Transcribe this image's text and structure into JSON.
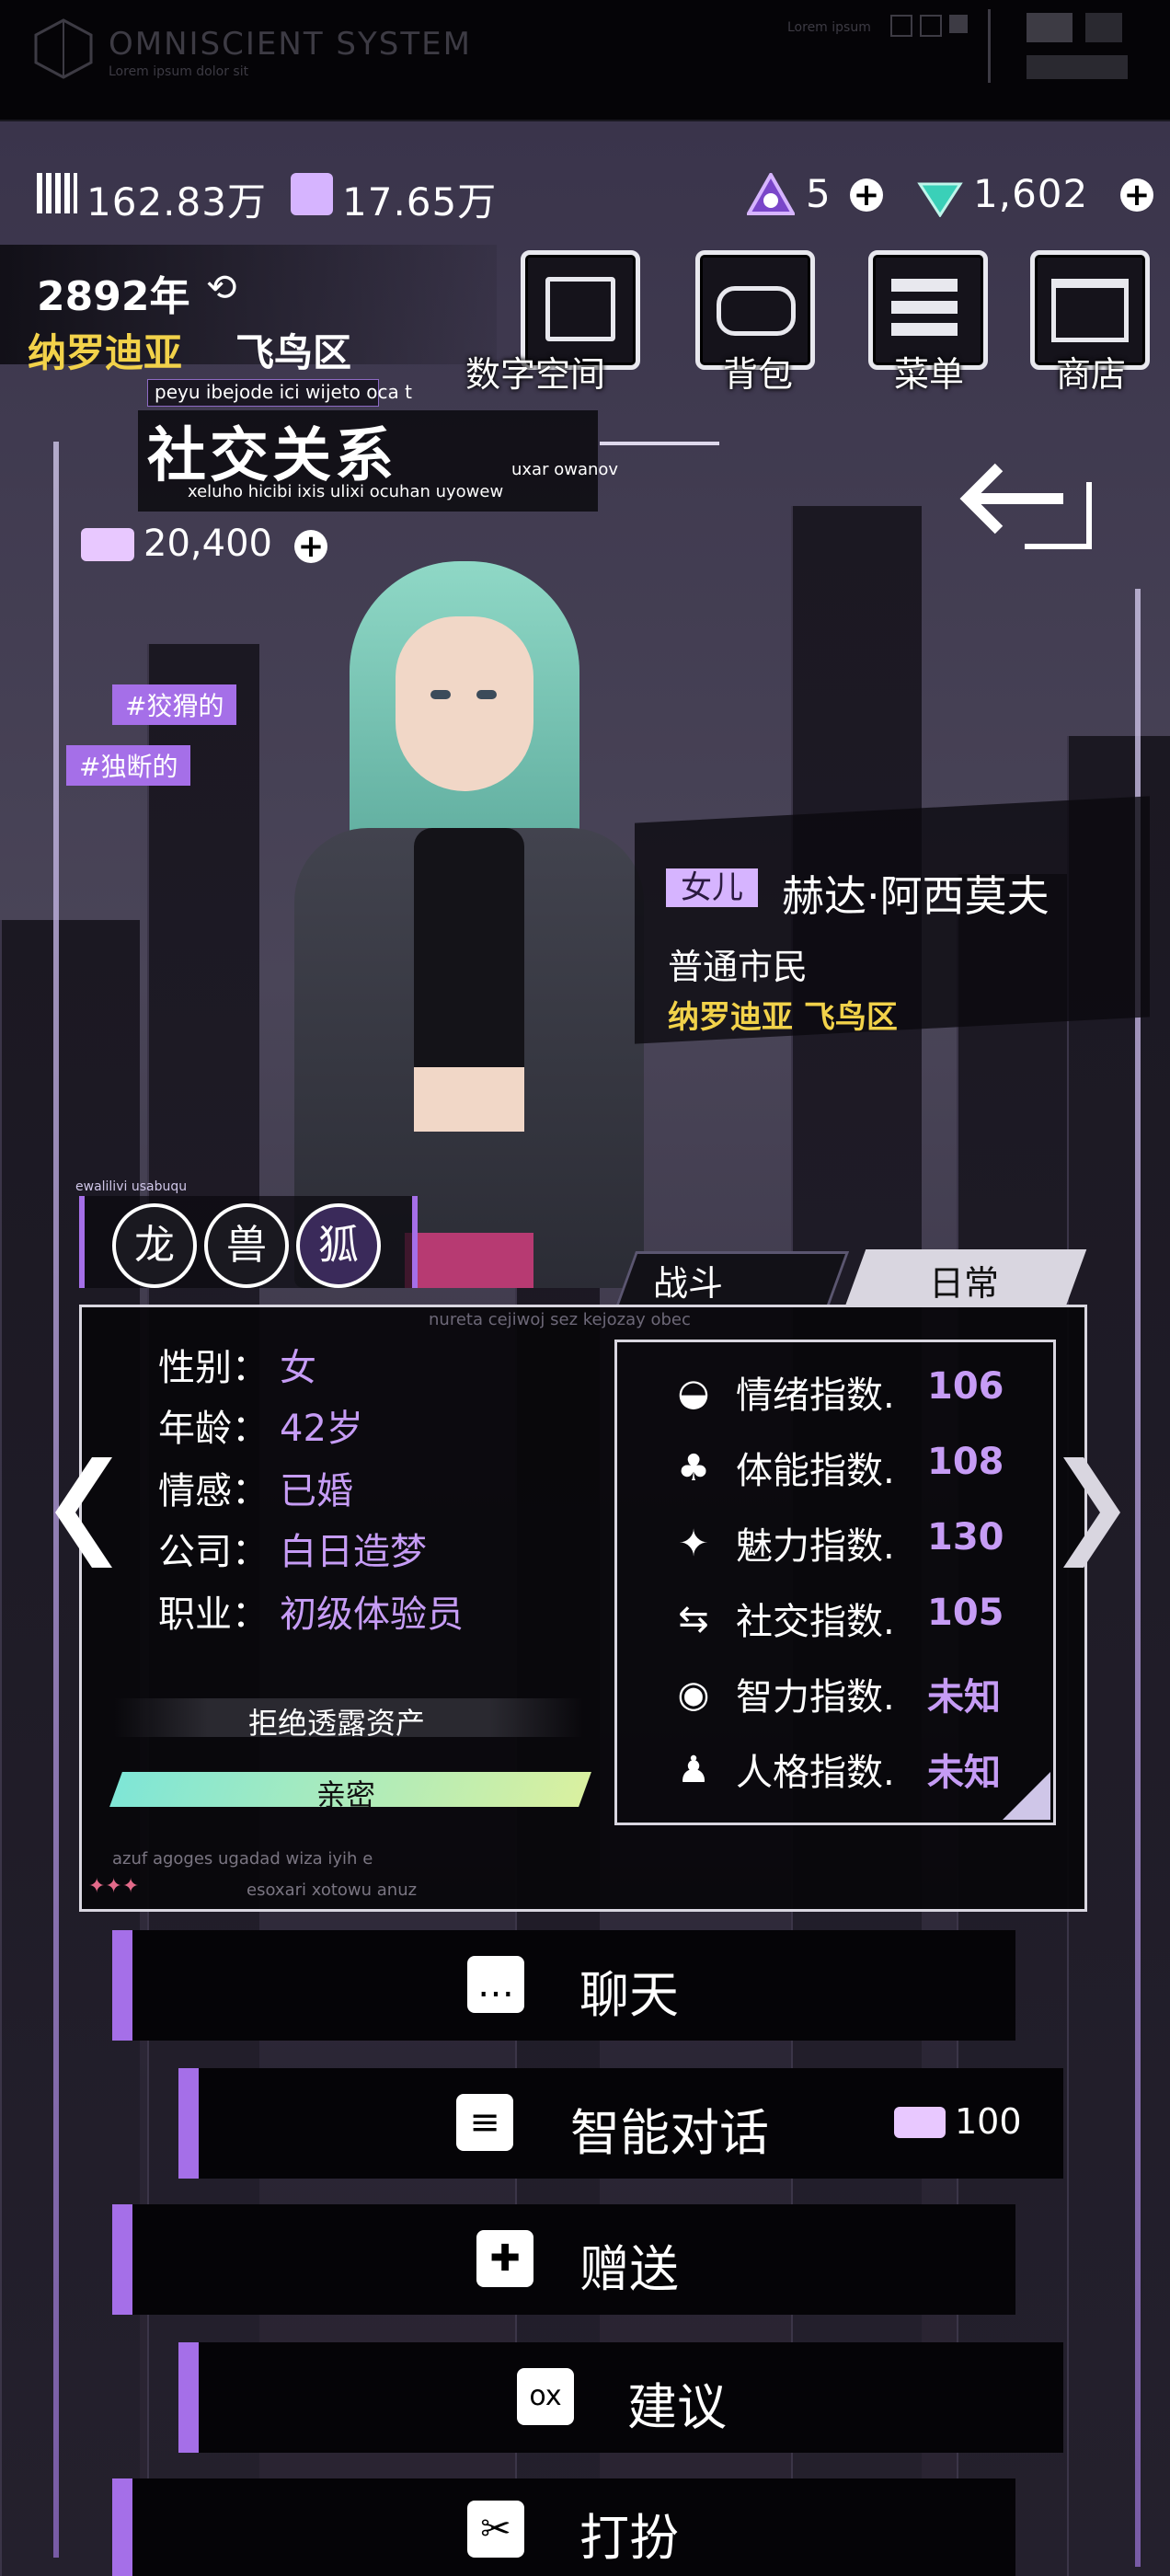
{
  "topbar": {
    "logo_title": "OMNISCIENT SYSTEM",
    "logo_sub": "Lorem ipsum dolor sit",
    "right_text": "Lorem ipsum"
  },
  "resources": {
    "coins": "162.83万",
    "crystals": "17.65万",
    "energy": "5",
    "gems": "1,602"
  },
  "location": {
    "year": "2892年",
    "city": "纳罗迪亚",
    "district": "飞鸟区"
  },
  "nav": {
    "digital_space": "数字空间",
    "bag": "背包",
    "menu": "菜单",
    "shop": "商店"
  },
  "page": {
    "title": "社交关系",
    "title_small_top": "peyu ibejode ici wijeto oca t",
    "title_small_right": "uxar owanov",
    "title_small_bottom": "xeluho hicibi ixis ulixi ocuhan uyowew",
    "ticket_balance": "20,400"
  },
  "tags": [
    "#狡猾的",
    "#独断的"
  ],
  "badges_caption": "ewalilivi usabuqu",
  "character": {
    "relation": "女儿",
    "name": "赫达·阿西莫夫",
    "occupation_class": "普通市民",
    "location": "纳罗迪亚 飞鸟区"
  },
  "tabs": {
    "battle": "战斗",
    "daily": "日常"
  },
  "panel_caption": "nureta cejiwoj sez kejozay obec",
  "profile": [
    {
      "label": "性别：",
      "value": "女"
    },
    {
      "label": "年龄：",
      "value": "42岁"
    },
    {
      "label": "情感：",
      "value": "已婚"
    },
    {
      "label": "公司：",
      "value": "白日造梦"
    },
    {
      "label": "职业：",
      "value": "初级体验员"
    }
  ],
  "assets_text": "拒绝透露资产",
  "relationship_level": "亲密",
  "relationship_fill": 1.0,
  "footer_small_1": "azuf agoges ugadad wiza iyih e",
  "footer_small_2": "esoxari xotowu anuz",
  "stats": [
    {
      "icon": "mood-icon",
      "label": "情绪指数.",
      "value": "106"
    },
    {
      "icon": "stamina-icon",
      "label": "体能指数.",
      "value": "108"
    },
    {
      "icon": "charm-icon",
      "label": "魅力指数.",
      "value": "130"
    },
    {
      "icon": "social-icon",
      "label": "社交指数.",
      "value": "105"
    },
    {
      "icon": "intelligence-icon",
      "label": "智力指数.",
      "value": "未知"
    },
    {
      "icon": "personality-icon",
      "label": "人格指数.",
      "value": "未知"
    }
  ],
  "actions": {
    "chat": "聊天",
    "ai_chat": "智能对话",
    "ai_chat_cost": "100",
    "gift": "赠送",
    "suggest": "建议",
    "dress": "打扮"
  },
  "colors": {
    "accent_purple": "#a56fe8",
    "value_purple": "#c69cf5",
    "location_yellow": "#f2d24a",
    "bar_start": "#7fe6d6",
    "bar_end": "#d9f0a0"
  }
}
